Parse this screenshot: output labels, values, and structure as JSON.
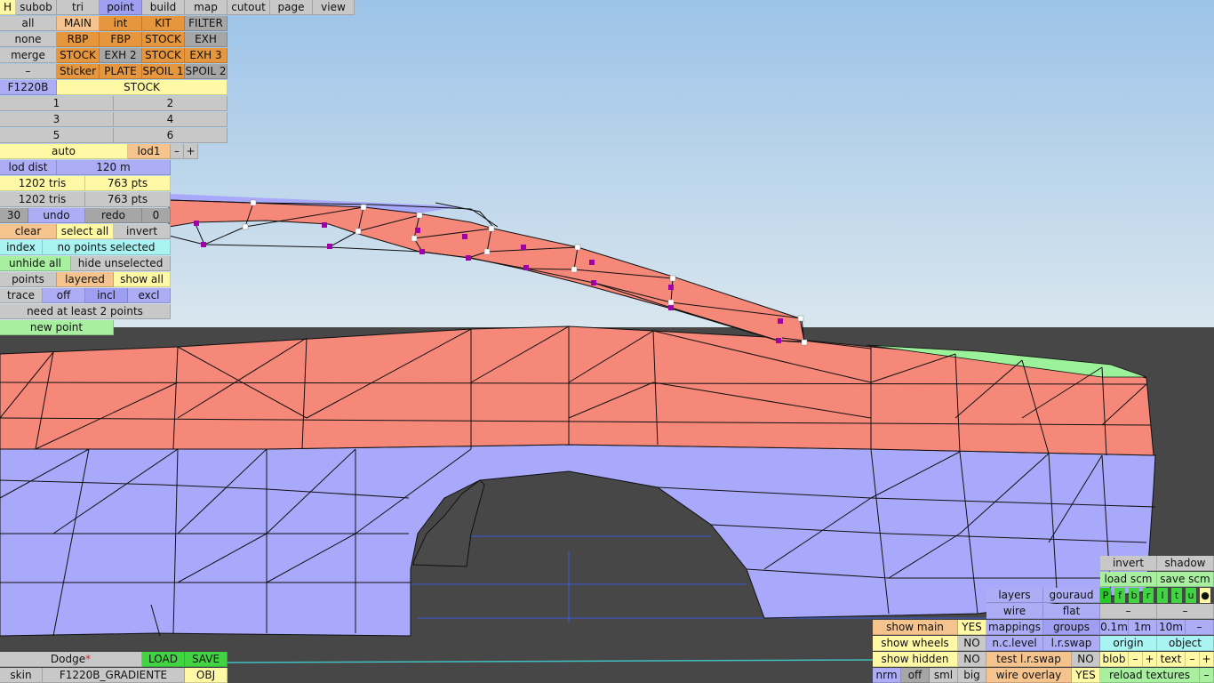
{
  "colors": {
    "sky_top": "#9cc3e8",
    "sky_bottom": "#d9e6ee",
    "floor": "#474747",
    "mesh_top": "#f6887a",
    "mesh_side": "#a9a9fc",
    "mesh_green": "#9cf29a",
    "selected_point": "#a000a8",
    "point": "#ffffff"
  },
  "top_bar": {
    "h": "H",
    "tabs": [
      "subob",
      "tri",
      "point",
      "build",
      "map",
      "cutout",
      "page",
      "view"
    ]
  },
  "filter": {
    "rows": [
      [
        "all",
        "MAIN",
        "int",
        "KIT",
        "FILTER"
      ],
      [
        "none",
        "RBP",
        "FBP",
        "STOCK",
        "EXH"
      ],
      [
        "merge",
        "STOCK",
        "EXH 2",
        "STOCK",
        "EXH 3"
      ],
      [
        "–",
        "Sticker",
        "PLATE",
        "SPOIL 1",
        "SPOIL 2"
      ]
    ],
    "name": "F1220B",
    "stock": "STOCK",
    "nums": [
      "1",
      "2",
      "3",
      "4",
      "5",
      "6"
    ]
  },
  "lod": {
    "auto": "auto",
    "level": "lod1",
    "minus": "–",
    "plus": "+",
    "dist_label": "lod dist",
    "dist_value": "120 m"
  },
  "stats": {
    "tris1": "1202 tris",
    "pts1": "763 pts",
    "tris2": "1202 tris",
    "pts2": "763 pts"
  },
  "history": {
    "count": "30",
    "undo": "undo",
    "redo": "redo",
    "redo_count": "0"
  },
  "selection": {
    "clear": "clear",
    "select_all": "select all",
    "invert": "invert",
    "index": "index",
    "status": "no points selected",
    "unhide_all": "unhide all",
    "hide_unselected": "hide unselected",
    "points": "points",
    "layered": "layered",
    "show_all": "show all",
    "trace": "trace",
    "off": "off",
    "incl": "incl",
    "excl": "excl",
    "hint": "need at least 2 points",
    "new_point": "new point"
  },
  "bottom_left": {
    "car": "Dodge",
    "modified": "*",
    "load": "LOAD",
    "save": "SAVE",
    "skin_label": "skin",
    "skin_value": "F1220B_GRADIENTE",
    "obj": "OBJ"
  },
  "bottom_center": {
    "show_main": "show main",
    "show_main_val": "YES",
    "show_wheels": "show wheels",
    "show_wheels_val": "NO",
    "show_hidden": "show hidden",
    "show_hidden_val": "NO",
    "nrm": "nrm",
    "off": "off",
    "sml": "sml",
    "big": "big"
  },
  "bottom_mid": {
    "layers": "layers",
    "gouraud": "gouraud",
    "wire": "wire",
    "flat": "flat",
    "mappings": "mappings",
    "groups": "groups",
    "nc_level": "n.c.level",
    "lr_swap": "l.r.swap",
    "test_lr_swap": "test l.r.swap",
    "test_val": "NO",
    "wire_overlay": "wire overlay",
    "wire_overlay_val": "YES"
  },
  "bottom_right": {
    "invert": "invert",
    "shadow": "shadow",
    "load_scm": "load scm",
    "save_scm": "save scm",
    "flags": [
      "P",
      "f",
      "b",
      "r",
      "l",
      "t",
      "u",
      "●"
    ],
    "dash1": "–",
    "dash2": "–",
    "d01": "0.1m",
    "d1": "1m",
    "d10": "10m",
    "dminus": "–",
    "origin": "origin",
    "object": "object",
    "blob": "blob",
    "blob_minus": "–",
    "blob_plus": "+",
    "text": "text",
    "text_minus": "–",
    "text_plus": "+",
    "reload": "reload textures",
    "reload_minus": "–"
  }
}
